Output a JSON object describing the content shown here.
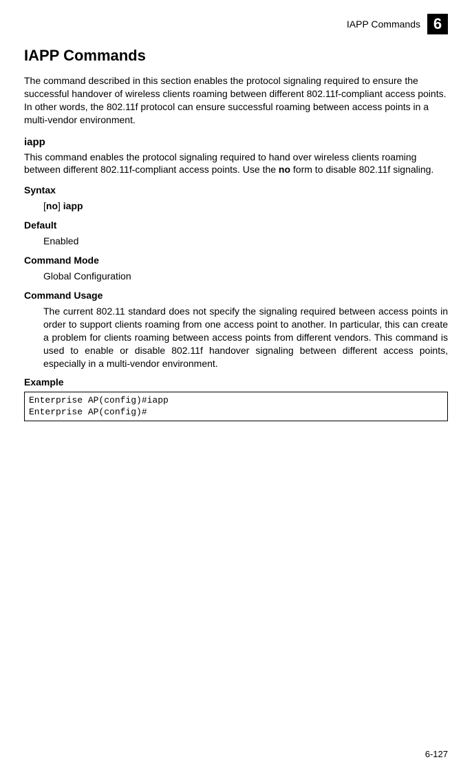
{
  "header": {
    "running_title": "IAPP Commands",
    "chapter_number": "6"
  },
  "section": {
    "title": "IAPP Commands",
    "intro": "The command described in this section enables the protocol signaling required to ensure the successful handover of wireless clients roaming between different 802.11f-compliant access points. In other words, the 802.11f protocol can ensure successful roaming between access points in a multi-vendor environment."
  },
  "command": {
    "name": "iapp",
    "desc_pre": "This command enables the protocol signaling required to hand over wireless clients roaming between different 802.11f-compliant access points. Use the ",
    "desc_bold": "no",
    "desc_post": " form to disable 802.11f signaling.",
    "syntax_label": "Syntax",
    "syntax_open": "[",
    "syntax_no": "no",
    "syntax_close": "] ",
    "syntax_cmd": "iapp",
    "default_label": "Default",
    "default_value": "Enabled",
    "mode_label": "Command Mode",
    "mode_value": "Global Configuration",
    "usage_label": "Command Usage",
    "usage_value": "The current 802.11 standard does not specify the signaling required between access points in order to support clients roaming from one access point to another. In particular, this can create a problem for clients roaming between access points from different vendors. This command is used to enable or disable 802.11f handover signaling between different access points, especially in a multi-vendor environment.",
    "example_label": "Example",
    "example_code": "Enterprise AP(config)#iapp\nEnterprise AP(config)#"
  },
  "footer": {
    "page_number": "6-127"
  }
}
